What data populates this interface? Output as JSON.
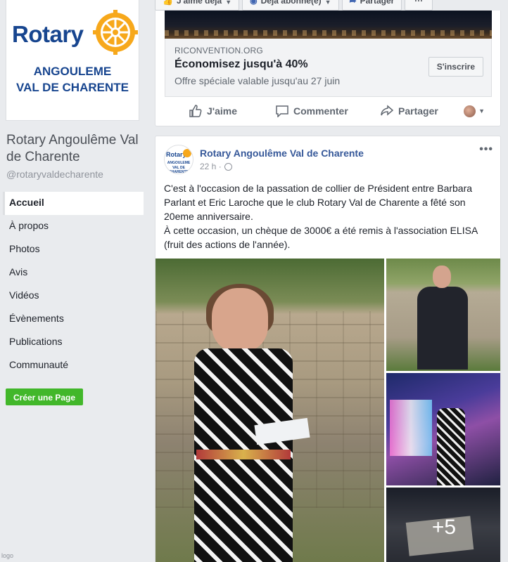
{
  "sidebar": {
    "logo": {
      "word": "Rotary",
      "line1": "ANGOULEME",
      "line2": "VAL DE CHARENTE"
    },
    "page_name": "Rotary Angoulême Val de Charente",
    "handle": "@rotaryvaldecharente",
    "nav": [
      {
        "label": "Accueil",
        "active": true
      },
      {
        "label": "À propos"
      },
      {
        "label": "Photos"
      },
      {
        "label": "Avis"
      },
      {
        "label": "Vidéos"
      },
      {
        "label": "Évènements"
      },
      {
        "label": "Publications"
      },
      {
        "label": "Communauté"
      }
    ],
    "create_page": "Créer une Page",
    "tiny_label": "logo"
  },
  "top_bar": {
    "like": "J'aime déjà",
    "follow": "Déjà abonné(e)",
    "share": "Partager",
    "more": "···"
  },
  "ad": {
    "domain": "RICONVENTION.ORG",
    "title": "Économisez jusqu'à 40%",
    "description": "Offre spéciale valable jusqu'au 27 juin",
    "cta": "S'inscrire",
    "actions": {
      "like": "J'aime",
      "comment": "Commenter",
      "share": "Partager"
    }
  },
  "post": {
    "author": "Rotary Angoulême Val de Charente",
    "time": "22 h ·",
    "avatar_word": "Rotary",
    "avatar_line1": "ANGOULEME",
    "avatar_line2": "VAL DE CHARENTE",
    "text": "C'est à l'occasion de la passation de collier de Président entre Barbara Parlant et Eric Laroche que le club Rotary Val de Charente a fêté son 20eme anniversaire.\nÀ cette occasion, un chèque de 3000€ a été remis à l'association ELISA (fruit des actions de l'année).",
    "more_photos": "+5"
  },
  "colors": {
    "rotary_blue": "#17458f",
    "rotary_gold": "#f7a81b",
    "fb_link": "#365899",
    "create_green": "#42b72a"
  },
  "icons": [
    "like-thumb-icon",
    "comment-icon",
    "share-arrow-icon",
    "globe-icon",
    "more-dots-icon",
    "rotary-wheel-icon"
  ]
}
